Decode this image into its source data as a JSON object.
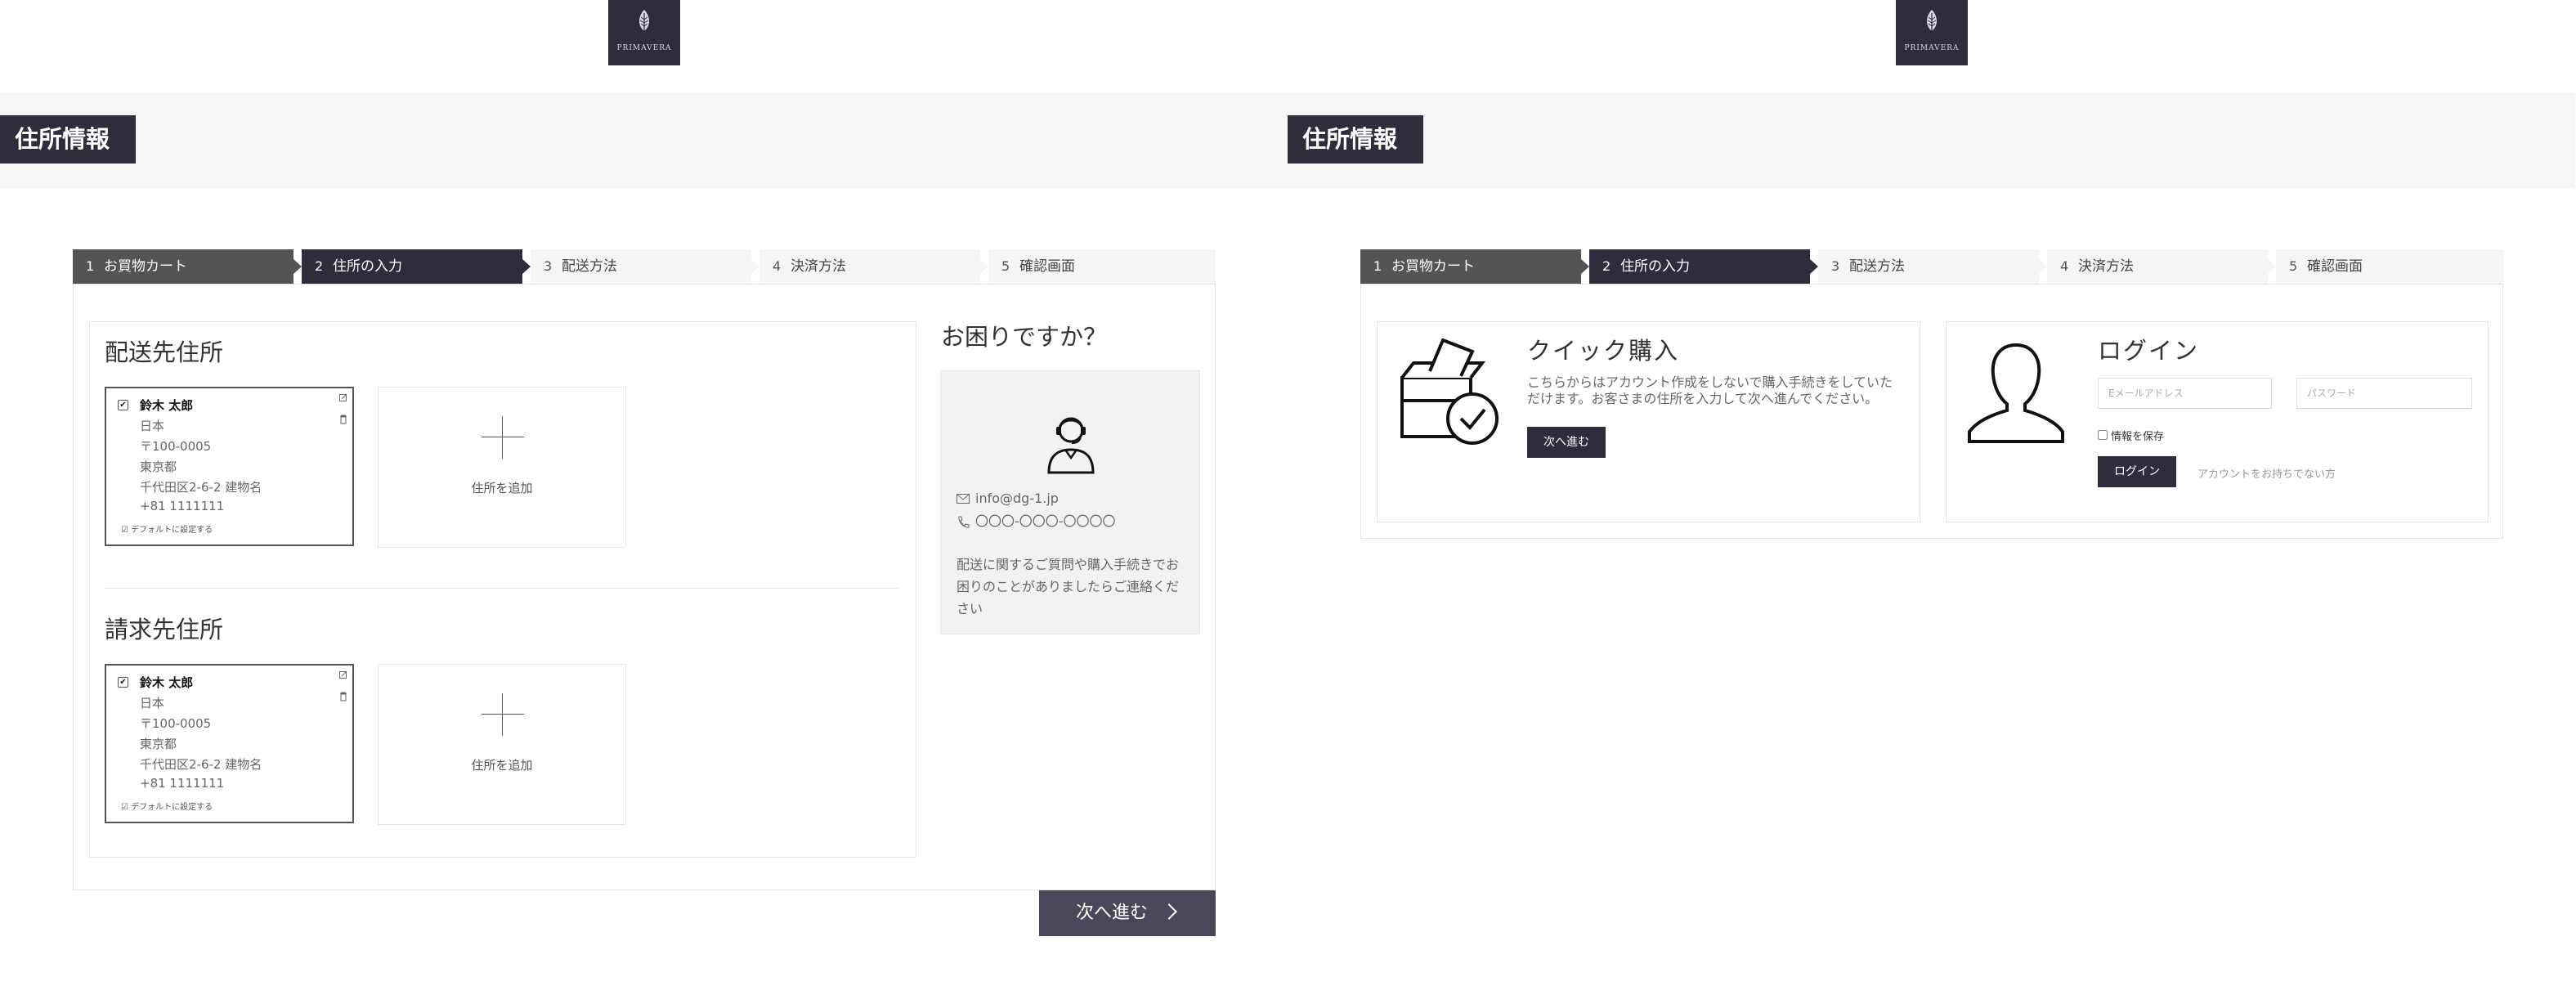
{
  "brand": {
    "name": "PRIMAVERA",
    "color": "#2f2d3c"
  },
  "page": {
    "title": "住所情報"
  },
  "steps": [
    {
      "num": "1",
      "label": "お買物カート"
    },
    {
      "num": "2",
      "label": "住所の入力"
    },
    {
      "num": "3",
      "label": "配送方法"
    },
    {
      "num": "4",
      "label": "決済方法"
    },
    {
      "num": "5",
      "label": "確認画面"
    }
  ],
  "shipping": {
    "title": "配送先住所",
    "card": {
      "name": "鈴木 太郎",
      "country": "日本",
      "zip": "〒100-0005",
      "pref": "東京都",
      "street": "千代田区2-6-2 建物名",
      "phone": "+81 1111111",
      "default_label": "デフォルトに設定する"
    },
    "add_label": "住所を追加"
  },
  "billing": {
    "title": "請求先住所",
    "card": {
      "name": "鈴木 太郎",
      "country": "日本",
      "zip": "〒100-0005",
      "pref": "東京都",
      "street": "千代田区2-6-2 建物名",
      "phone": "+81 1111111",
      "default_label": "デフォルトに設定する"
    },
    "add_label": "住所を追加"
  },
  "help": {
    "title": "お困りですか？",
    "email": "info@dg-1.jp",
    "phone": "〇〇〇-〇〇〇-〇〇〇〇",
    "message_lines": [
      "配送に関するご質問や購入手続きでお",
      "困りのことがありましたらご連絡くだ",
      "さい"
    ]
  },
  "next_button": "次へ進む",
  "quick": {
    "title": "クイック購入",
    "desc_lines": [
      "こちらからはアカウント作成をしないで購入手続きをしていた",
      "だけます。お客さまの住所を入力して次へ進んでください。"
    ],
    "button": "次へ進む"
  },
  "login": {
    "title": "ログイン",
    "email_placeholder": "Eメールアドレス",
    "password_placeholder": "パスワード",
    "remember": "情報を保存",
    "button": "ログイン",
    "no_account": "アカウントをお持ちでない方"
  }
}
